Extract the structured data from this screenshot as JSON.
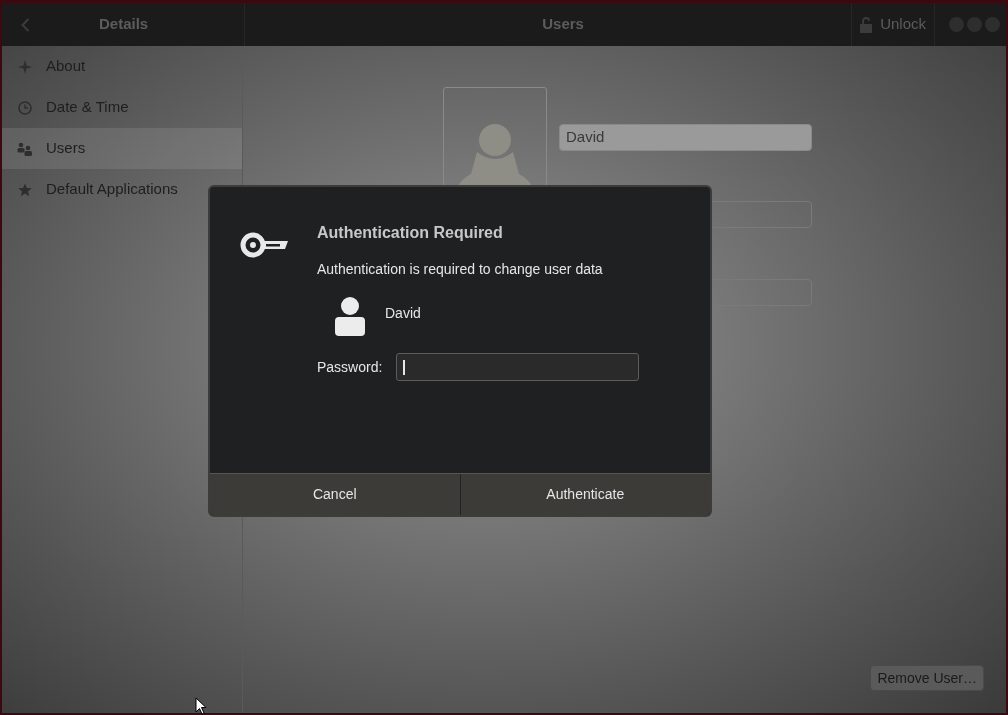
{
  "header": {
    "back_label": "Details",
    "title": "Users",
    "unlock_button": "Unlock"
  },
  "sidebar": {
    "items": [
      {
        "label": "About",
        "kind": "about",
        "selected": false
      },
      {
        "label": "Date & Time",
        "kind": "clock",
        "selected": false
      },
      {
        "label": "Users",
        "kind": "users",
        "selected": true
      },
      {
        "label": "Default Applications",
        "kind": "star",
        "selected": false
      }
    ]
  },
  "user_panel": {
    "name": "David",
    "remove_button": "Remove User…"
  },
  "dialog": {
    "title": "Authentication Required",
    "message": "Authentication is required to change user data",
    "user": "David",
    "password_label": "Password:",
    "buttons": [
      "Cancel",
      "Authenticate"
    ]
  }
}
